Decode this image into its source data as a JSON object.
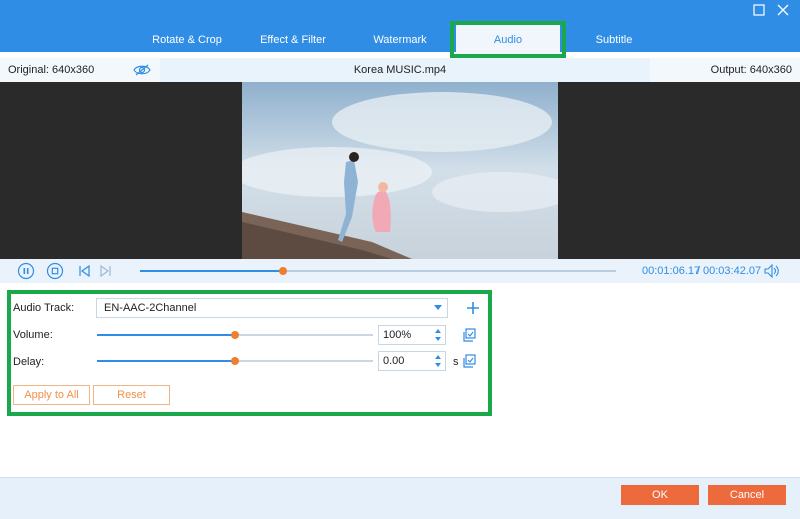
{
  "tabs": [
    {
      "label": "Rotate & Crop"
    },
    {
      "label": "Effect & Filter"
    },
    {
      "label": "Watermark"
    },
    {
      "label": "Audio",
      "active": true
    },
    {
      "label": "Subtitle"
    }
  ],
  "info": {
    "original": "Original: 640x360",
    "filename": "Korea MUSIC.mp4",
    "output": "Output: 640x360"
  },
  "player": {
    "current_time": "00:01:06.17",
    "separator": "/",
    "total_time": "00:03:42.07",
    "progress_percent": 30
  },
  "audio": {
    "track_label": "Audio Track:",
    "track_value": "EN-AAC-2Channel",
    "volume_label": "Volume:",
    "volume_value": "100%",
    "volume_level_percent": 50,
    "delay_label": "Delay:",
    "delay_value": "0.00",
    "delay_unit": "s",
    "delay_level_percent": 50,
    "apply_all": "Apply to All",
    "reset": "Reset"
  },
  "footer": {
    "ok": "OK",
    "cancel": "Cancel"
  },
  "colors": {
    "accent": "#2f8de6",
    "orange": "#ec6a3c",
    "highlight": "#1aa84a"
  },
  "icons": [
    "maximize-icon",
    "close-icon",
    "eye-slash-icon",
    "pause-icon",
    "stop-icon",
    "previous-icon",
    "next-icon",
    "volume-icon",
    "plus-icon",
    "copy-icon"
  ]
}
